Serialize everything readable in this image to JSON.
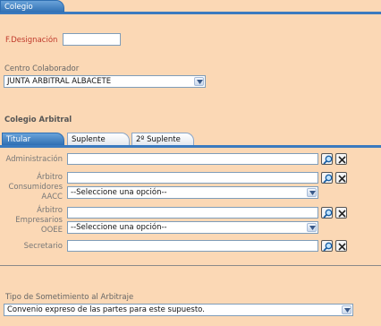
{
  "header": {
    "tab_label": "Colegio"
  },
  "designacion": {
    "label": "F.Designación",
    "value": ""
  },
  "centro": {
    "label": "Centro Colaborador",
    "selected": "JUNTA ARBITRAL ALBACETE"
  },
  "colegio": {
    "title": "Colegio Arbitral",
    "tabs": [
      {
        "label": "Titular"
      },
      {
        "label": "Suplente"
      },
      {
        "label": "2º Suplente"
      }
    ],
    "rows": {
      "administracion": {
        "label": "Administración",
        "value": ""
      },
      "arbitro_consumidores": {
        "label_line1": "Árbitro",
        "label_line2": "Consumidores",
        "label_line3": "AACC",
        "value": "",
        "select": "--Seleccione una opción--"
      },
      "arbitro_empresarios": {
        "label_line1": "Árbitro",
        "label_line2": "Empresarios",
        "label_line3": "OOEE",
        "value": "",
        "select": "--Seleccione una opción--"
      },
      "secretario": {
        "label": "Secretario",
        "value": ""
      }
    }
  },
  "sometimiento": {
    "label": "Tipo de Sometimiento al Arbitraje",
    "selected": "Convenio expreso de las partes para este supuesto."
  },
  "icons": {
    "search": "search-icon",
    "clear": "close-icon"
  },
  "colors": {
    "background": "#fbd8b5",
    "accent": "#3a7abf",
    "label_red": "#c0392b"
  }
}
